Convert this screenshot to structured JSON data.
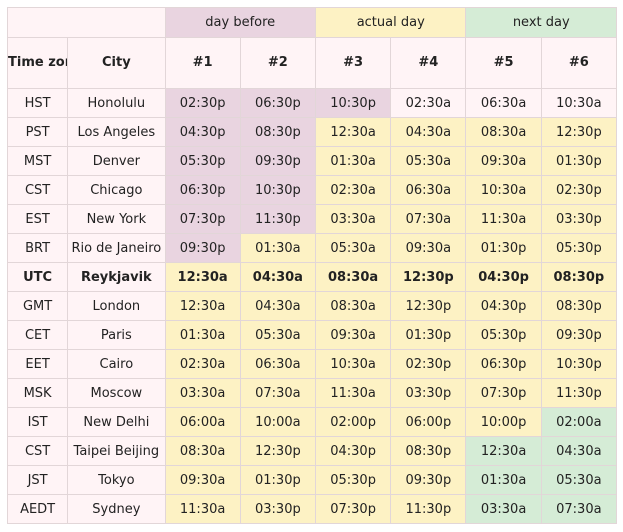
{
  "groups": {
    "day_before": "day before",
    "actual_day": "actual day",
    "next_day": "next day"
  },
  "headers": {
    "time_zone": "Time zone",
    "city": "City",
    "slots": [
      "#1",
      "#2",
      "#3",
      "#4",
      "#5",
      "#6"
    ]
  },
  "colors": {
    "day_before": "#e9d4e0",
    "actual_day": "#fdf2c4",
    "next_day": "#d5ecd6",
    "default": "#fff4f6"
  },
  "rows": [
    {
      "tz": "HST",
      "city": "Honolulu",
      "times": [
        "02:30p",
        "06:30p",
        "10:30p",
        "02:30a",
        "06:30a",
        "10:30a"
      ],
      "days": [
        "before",
        "before",
        "before",
        "default",
        "default",
        "default"
      ]
    },
    {
      "tz": "PST",
      "city": "Los Angeles",
      "times": [
        "04:30p",
        "08:30p",
        "12:30a",
        "04:30a",
        "08:30a",
        "12:30p"
      ],
      "days": [
        "before",
        "before",
        "actual",
        "actual",
        "actual",
        "actual"
      ]
    },
    {
      "tz": "MST",
      "city": "Denver",
      "times": [
        "05:30p",
        "09:30p",
        "01:30a",
        "05:30a",
        "09:30a",
        "01:30p"
      ],
      "days": [
        "before",
        "before",
        "actual",
        "actual",
        "actual",
        "actual"
      ]
    },
    {
      "tz": "CST",
      "city": "Chicago",
      "times": [
        "06:30p",
        "10:30p",
        "02:30a",
        "06:30a",
        "10:30a",
        "02:30p"
      ],
      "days": [
        "before",
        "before",
        "actual",
        "actual",
        "actual",
        "actual"
      ]
    },
    {
      "tz": "EST",
      "city": "New York",
      "times": [
        "07:30p",
        "11:30p",
        "03:30a",
        "07:30a",
        "11:30a",
        "03:30p"
      ],
      "days": [
        "before",
        "before",
        "actual",
        "actual",
        "actual",
        "actual"
      ]
    },
    {
      "tz": "BRT",
      "city": "Rio de Janeiro",
      "times": [
        "09:30p",
        "01:30a",
        "05:30a",
        "09:30a",
        "01:30p",
        "05:30p"
      ],
      "days": [
        "before",
        "actual",
        "actual",
        "actual",
        "actual",
        "actual"
      ]
    },
    {
      "tz": "UTC",
      "city": "Reykjavik",
      "times": [
        "12:30a",
        "04:30a",
        "08:30a",
        "12:30p",
        "04:30p",
        "08:30p"
      ],
      "days": [
        "actual",
        "actual",
        "actual",
        "actual",
        "actual",
        "actual"
      ],
      "bold": true
    },
    {
      "tz": "GMT",
      "city": "London",
      "times": [
        "12:30a",
        "04:30a",
        "08:30a",
        "12:30p",
        "04:30p",
        "08:30p"
      ],
      "days": [
        "actual",
        "actual",
        "actual",
        "actual",
        "actual",
        "actual"
      ]
    },
    {
      "tz": "CET",
      "city": "Paris",
      "times": [
        "01:30a",
        "05:30a",
        "09:30a",
        "01:30p",
        "05:30p",
        "09:30p"
      ],
      "days": [
        "actual",
        "actual",
        "actual",
        "actual",
        "actual",
        "actual"
      ]
    },
    {
      "tz": "EET",
      "city": "Cairo",
      "times": [
        "02:30a",
        "06:30a",
        "10:30a",
        "02:30p",
        "06:30p",
        "10:30p"
      ],
      "days": [
        "actual",
        "actual",
        "actual",
        "actual",
        "actual",
        "actual"
      ]
    },
    {
      "tz": "MSK",
      "city": "Moscow",
      "times": [
        "03:30a",
        "07:30a",
        "11:30a",
        "03:30p",
        "07:30p",
        "11:30p"
      ],
      "days": [
        "actual",
        "actual",
        "actual",
        "actual",
        "actual",
        "actual"
      ]
    },
    {
      "tz": "IST",
      "city": "New Delhi",
      "times": [
        "06:00a",
        "10:00a",
        "02:00p",
        "06:00p",
        "10:00p",
        "02:00a"
      ],
      "days": [
        "actual",
        "actual",
        "actual",
        "actual",
        "actual",
        "next"
      ]
    },
    {
      "tz": "CST",
      "city": "Taipei Beijing",
      "times": [
        "08:30a",
        "12:30p",
        "04:30p",
        "08:30p",
        "12:30a",
        "04:30a"
      ],
      "days": [
        "actual",
        "actual",
        "actual",
        "actual",
        "next",
        "next"
      ]
    },
    {
      "tz": "JST",
      "city": "Tokyo",
      "times": [
        "09:30a",
        "01:30p",
        "05:30p",
        "09:30p",
        "01:30a",
        "05:30a"
      ],
      "days": [
        "actual",
        "actual",
        "actual",
        "actual",
        "next",
        "next"
      ]
    },
    {
      "tz": "AEDT",
      "city": "Sydney",
      "times": [
        "11:30a",
        "03:30p",
        "07:30p",
        "11:30p",
        "03:30a",
        "07:30a"
      ],
      "days": [
        "actual",
        "actual",
        "actual",
        "actual",
        "next",
        "next"
      ]
    }
  ]
}
